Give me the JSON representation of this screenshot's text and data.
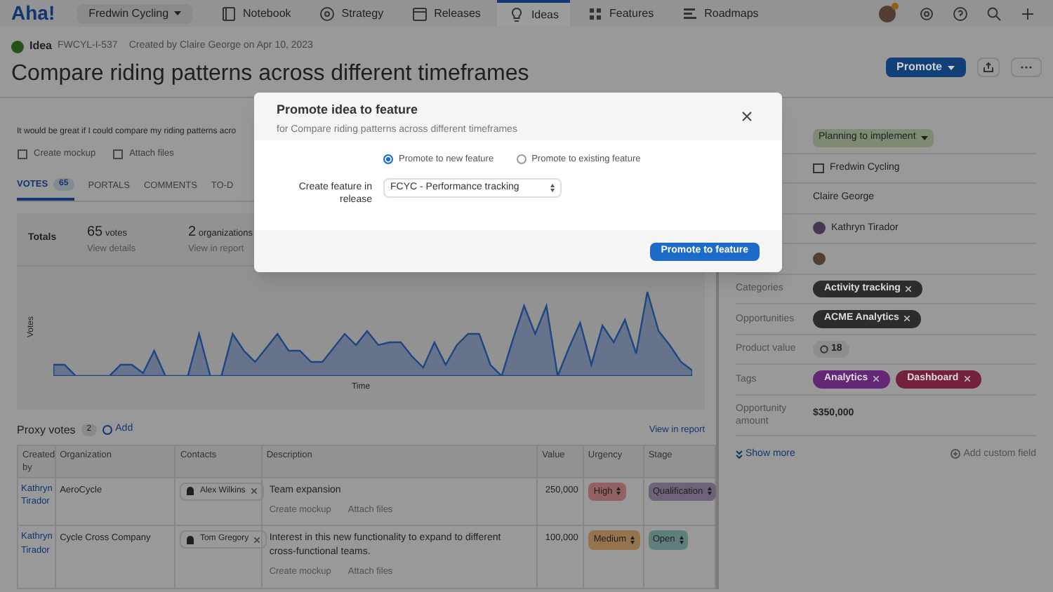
{
  "nav": {
    "logo": "Aha!",
    "workspace": "Fredwin Cycling",
    "items": [
      {
        "label": "Notebook",
        "selected": false
      },
      {
        "label": "Strategy",
        "selected": false
      },
      {
        "label": "Releases",
        "selected": false
      },
      {
        "label": "Ideas",
        "selected": true
      },
      {
        "label": "Features",
        "selected": false
      },
      {
        "label": "Roadmaps",
        "selected": false
      }
    ]
  },
  "header": {
    "type": "Idea",
    "ref": "FWCYL-I-537",
    "created": "Created by Claire George on Apr 10, 2023",
    "title": "Compare riding patterns across different timeframes",
    "promote": "Promote"
  },
  "description": "It would be great if I could compare my riding patterns acro",
  "desc_actions": [
    "Create mockup",
    "Attach files"
  ],
  "tabs": [
    {
      "label": "VOTES",
      "count": "65",
      "selected": true
    },
    {
      "label": "PORTALS",
      "selected": false
    },
    {
      "label": "COMMENTS",
      "selected": false
    },
    {
      "label": "TO-D",
      "selected": false
    }
  ],
  "totals": {
    "label": "Totals",
    "stats": [
      {
        "number": "65",
        "unit": "votes",
        "link": "View details"
      },
      {
        "number": "2",
        "unit": "organizations",
        "link": "View in report"
      }
    ]
  },
  "chart": {
    "ylabel": "Votes",
    "xlabel": "Time"
  },
  "proxy": {
    "title": "Proxy votes",
    "count": "2",
    "add": "Add",
    "report": "View in report",
    "columns": [
      "Created by",
      "Organization",
      "Contacts",
      "Description",
      "Value",
      "Urgency",
      "Stage"
    ],
    "rows": [
      {
        "created_by": "Kathryn Tirador",
        "organization": "AeroCycle",
        "contact": "Alex Wilkins",
        "description": "Team expansion",
        "actions": [
          "Create mockup",
          "Attach files"
        ],
        "value": "250,000",
        "urgency": {
          "label": "High",
          "color": "#926262"
        },
        "stage": {
          "label": "Qualification",
          "color": "#6d6379"
        }
      },
      {
        "created_by": "Kathryn Tirador",
        "organization": "Cycle Cross Company",
        "contact": "Tom Gregory",
        "description": "Interest in this new functionality to expand to different cross-functional teams.",
        "actions": [
          "Create mockup",
          "Attach files"
        ],
        "value": "100,000",
        "urgency": {
          "label": "Medium",
          "color": "#94744c"
        },
        "stage": {
          "label": "Open",
          "color": "#5f7f7c"
        }
      }
    ]
  },
  "sidebar": [
    {
      "kind": "status",
      "value": "Planning to implement"
    },
    {
      "kind": "workspace",
      "value": "Fredwin Cycling"
    },
    {
      "kind": "text",
      "value": "Claire George"
    },
    {
      "kind": "user",
      "value": "Kathryn Tirador"
    },
    {
      "kind": "avatar"
    },
    {
      "kind": "chips",
      "label": "Categories",
      "chips": [
        {
          "text": "Activity tracking",
          "color": "#2c2c2c"
        }
      ]
    },
    {
      "kind": "chips",
      "label": "Opportunities",
      "chips": [
        {
          "text": "ACME Analytics",
          "color": "#2c2c2c"
        }
      ]
    },
    {
      "kind": "score",
      "label": "Product value",
      "value": "18"
    },
    {
      "kind": "chips",
      "label": "Tags",
      "chips": [
        {
          "text": "Analytics",
          "color": "#642676"
        },
        {
          "text": "Dashboard",
          "color": "#742140"
        }
      ]
    },
    {
      "kind": "amount",
      "label": "Opportunity amount",
      "value": "$350,000"
    }
  ],
  "show_more": "Show more",
  "add_custom": "Add custom field",
  "modal": {
    "title": "Promote idea to feature",
    "subtitle": "for Compare riding patterns across different timeframes",
    "options": [
      {
        "label": "Promote to new feature",
        "selected": true
      },
      {
        "label": "Promote to existing feature",
        "selected": false
      }
    ],
    "release_label": "Create feature in release",
    "release_value": "FCYC - Performance tracking",
    "submit": "Promote to feature"
  }
}
